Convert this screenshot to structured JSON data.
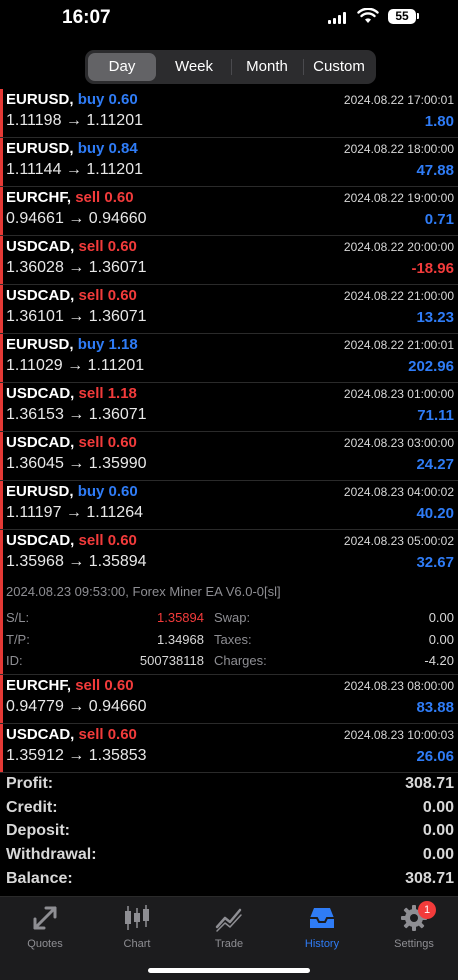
{
  "status": {
    "time": "16:07",
    "battery": "55"
  },
  "periods": {
    "day": "Day",
    "week": "Week",
    "month": "Month",
    "custom": "Custom",
    "selected": "Day"
  },
  "trades": [
    {
      "symbol": "EURUSD,",
      "type": "buy 0.60",
      "side": "buy",
      "prices": "1.11198 → 1.11201",
      "time": "2024.08.22 17:00:01",
      "profit": "1.80"
    },
    {
      "symbol": "EURUSD,",
      "type": "buy 0.84",
      "side": "buy",
      "prices": "1.11144 → 1.11201",
      "time": "2024.08.22 18:00:00",
      "profit": "47.88"
    },
    {
      "symbol": "EURCHF,",
      "type": "sell 0.60",
      "side": "sell",
      "prices": "0.94661 → 0.94660",
      "time": "2024.08.22 19:00:00",
      "profit": "0.71"
    },
    {
      "symbol": "USDCAD,",
      "type": "sell 0.60",
      "side": "sell",
      "prices": "1.36028 → 1.36071",
      "time": "2024.08.22 20:00:00",
      "profit": "-18.96"
    },
    {
      "symbol": "USDCAD,",
      "type": "sell 0.60",
      "side": "sell",
      "prices": "1.36101 → 1.36071",
      "time": "2024.08.22 21:00:00",
      "profit": "13.23"
    },
    {
      "symbol": "EURUSD,",
      "type": "buy 1.18",
      "side": "buy",
      "prices": "1.11029 → 1.11201",
      "time": "2024.08.22 21:00:01",
      "profit": "202.96"
    },
    {
      "symbol": "USDCAD,",
      "type": "sell 1.18",
      "side": "sell",
      "prices": "1.36153 → 1.36071",
      "time": "2024.08.23 01:00:00",
      "profit": "71.11"
    },
    {
      "symbol": "USDCAD,",
      "type": "sell 0.60",
      "side": "sell",
      "prices": "1.36045 → 1.35990",
      "time": "2024.08.23 03:00:00",
      "profit": "24.27"
    },
    {
      "symbol": "EURUSD,",
      "type": "buy 0.60",
      "side": "buy",
      "prices": "1.11197 → 1.11264",
      "time": "2024.08.23 04:00:02",
      "profit": "40.20"
    },
    {
      "symbol": "USDCAD,",
      "type": "sell 0.60",
      "side": "sell",
      "prices": "1.35968 → 1.35894",
      "time": "2024.08.23 05:00:02",
      "profit": "32.67"
    }
  ],
  "detail": {
    "comment": "2024.08.23 09:53:00, Forex Miner EA V6.0-0[sl]",
    "sl_label": "S/L:",
    "sl_value": "1.35894",
    "tp_label": "T/P:",
    "tp_value": "1.34968",
    "id_label": "ID:",
    "id_value": "500738118",
    "swap_label": "Swap:",
    "swap_value": "0.00",
    "taxes_label": "Taxes:",
    "taxes_value": "0.00",
    "charges_label": "Charges:",
    "charges_value": "-4.20"
  },
  "trades_after": [
    {
      "symbol": "EURCHF,",
      "type": "sell 0.60",
      "side": "sell",
      "prices": "0.94779 → 0.94660",
      "time": "2024.08.23 08:00:00",
      "profit": "83.88"
    },
    {
      "symbol": "USDCAD,",
      "type": "sell 0.60",
      "side": "sell",
      "prices": "1.35912 → 1.35853",
      "time": "2024.08.23 10:00:03",
      "profit": "26.06"
    }
  ],
  "summary": [
    {
      "label": "Profit:",
      "value": "308.71"
    },
    {
      "label": "Credit:",
      "value": "0.00"
    },
    {
      "label": "Deposit:",
      "value": "0.00"
    },
    {
      "label": "Withdrawal:",
      "value": "0.00"
    },
    {
      "label": "Balance:",
      "value": "308.71"
    }
  ],
  "tabs": {
    "quotes": "Quotes",
    "chart": "Chart",
    "trade": "Trade",
    "history": "History",
    "settings": "Settings",
    "settings_badge": "1",
    "active": "History"
  },
  "colors": {
    "accent": "#2f7cf6",
    "negative": "#f23b3b",
    "background": "#000000"
  }
}
